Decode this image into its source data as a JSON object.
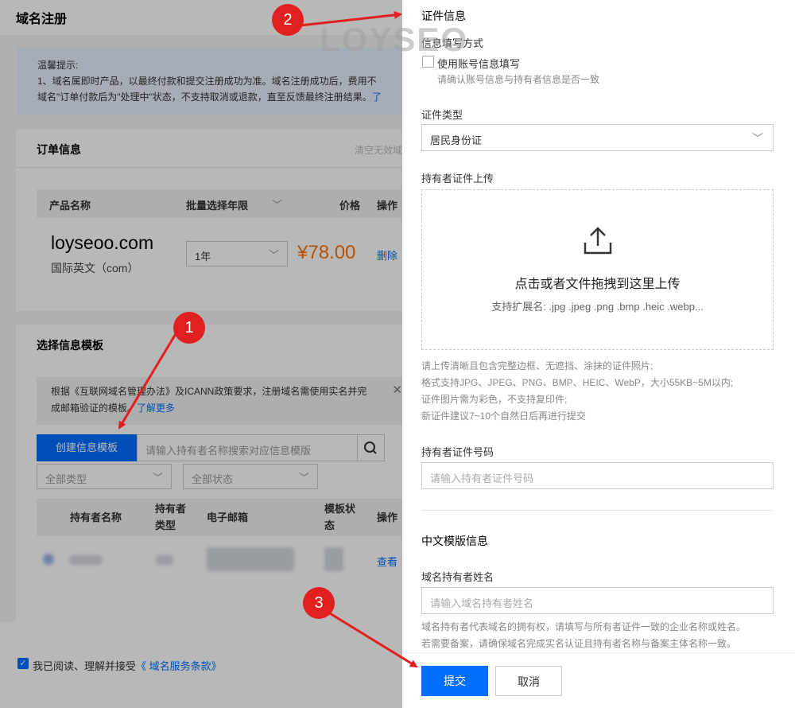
{
  "left": {
    "page_title": "域名注册",
    "notice": {
      "heading": "温馨提示:",
      "line1": "1、域名属即时产品，以最终付款和提交注册成功为准。域名注册成功后，费用不",
      "line2": "域名\"订单付款后为\"处理中\"状态，不支持取消或退款，直至反馈最终注册结果。",
      "link": "了"
    },
    "order": {
      "title": "订单信息",
      "clear": "清空无效域",
      "columns": {
        "product": "产品名称",
        "batch": "批量选择年限",
        "price": "价格",
        "action": "操作"
      },
      "item": {
        "domain": "loyseoo.com",
        "type": "国际英文（com）",
        "years": "1年",
        "price": "¥78.00",
        "delete": "删除"
      }
    },
    "template": {
      "title": "选择信息模板",
      "notice_line1": "根据《互联网域名管理办法》及ICANN政策要求，注册域名需使用实名并完",
      "notice_line2": "成邮箱验证的模板。",
      "learn_more": "了解更多",
      "create_button": "创建信息模板",
      "search_placeholder": "请输入持有者名称搜索对应信息模版",
      "filter_type": "全部类型",
      "filter_status": "全部状态",
      "columns": {
        "holder_name": "持有者名称",
        "holder_type_1": "持有者",
        "holder_type_2": "类型",
        "email": "电子邮箱",
        "status_1": "模板状",
        "status_2": "态",
        "action": "操作"
      },
      "row_action": "查看"
    },
    "agreement": {
      "text": "我已阅读、理解并接受",
      "link": "《 域名服务条款》"
    }
  },
  "panel": {
    "section_cert": "证件信息",
    "fill_method_label": "信息填写方式",
    "use_account_label": "使用账号信息填写",
    "use_account_hint": "请确认账号信息与持有者信息是否一致",
    "cert_type_label": "证件类型",
    "cert_type_value": "居民身份证",
    "upload_label": "持有者证件上传",
    "upload_main": "点击或者文件拖拽到这里上传",
    "upload_ext": "支持扩展名: .jpg .jpeg .png .bmp .heic .webp...",
    "upload_notes": [
      "请上传清晰且包含完整边框、无遮挡、涂抹的证件照片;",
      "格式支持JPG、JPEG、PNG、BMP、HEIC、WebP，大小55KB~5M以内;",
      "证件图片需为彩色，不支持复印件;",
      "新证件建议7~10个自然日后再进行提交"
    ],
    "cert_number_label": "持有者证件号码",
    "cert_number_placeholder": "请输入持有者证件号码",
    "cn_section_title": "中文模版信息",
    "holder_name_label": "域名持有者姓名",
    "holder_name_placeholder": "请输入域名持有者姓名",
    "holder_notes": [
      "域名持有者代表域名的拥有权，请填写与所有者证件一致的企业名称或姓名。",
      "若需要备案，请确保域名完成实名认证且持有者名称与备案主体名称一致。"
    ],
    "submit": "提交",
    "cancel": "取消"
  },
  "annotations": {
    "badge1": "1",
    "badge2": "2",
    "badge3": "3",
    "watermark": "LOYSEO"
  },
  "colors": {
    "primary": "#006eff",
    "price": "#ff7200",
    "annotation": "#e02020"
  }
}
